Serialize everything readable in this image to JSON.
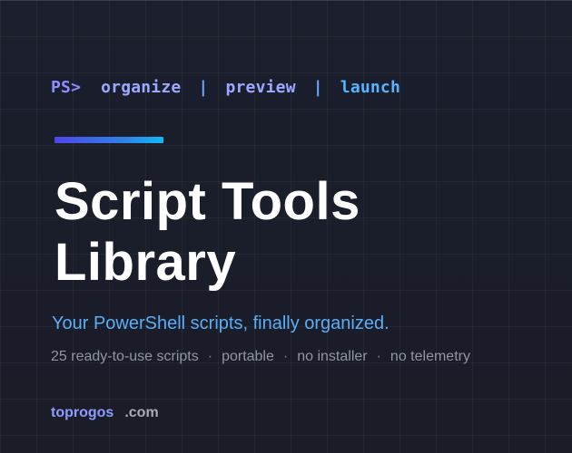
{
  "prompt": {
    "prefix": "PS>",
    "commands": [
      "organize",
      "preview",
      "launch"
    ],
    "separator": "|"
  },
  "title": {
    "line1": "Script Tools",
    "line2": "Library"
  },
  "tagline": "Your PowerShell scripts, finally organized.",
  "features": {
    "items": [
      "25 ready-to-use scripts",
      "portable",
      "no installer",
      "no telemetry"
    ],
    "separator": "·"
  },
  "brand": {
    "name": "toprogos",
    "tld": ".com"
  },
  "colors": {
    "background": "#1b1f2d",
    "prompt_prefix": "#8b8fff",
    "command": "#9ba9ff",
    "command_launch": "#57b4ff",
    "accent_start": "#5145e8",
    "accent_end": "#12b9f6",
    "title": "#ffffff",
    "tagline": "#59aef5",
    "features": "#9096a4",
    "brand_name": "#8e9bff",
    "brand_tld": "#a6abb7"
  }
}
